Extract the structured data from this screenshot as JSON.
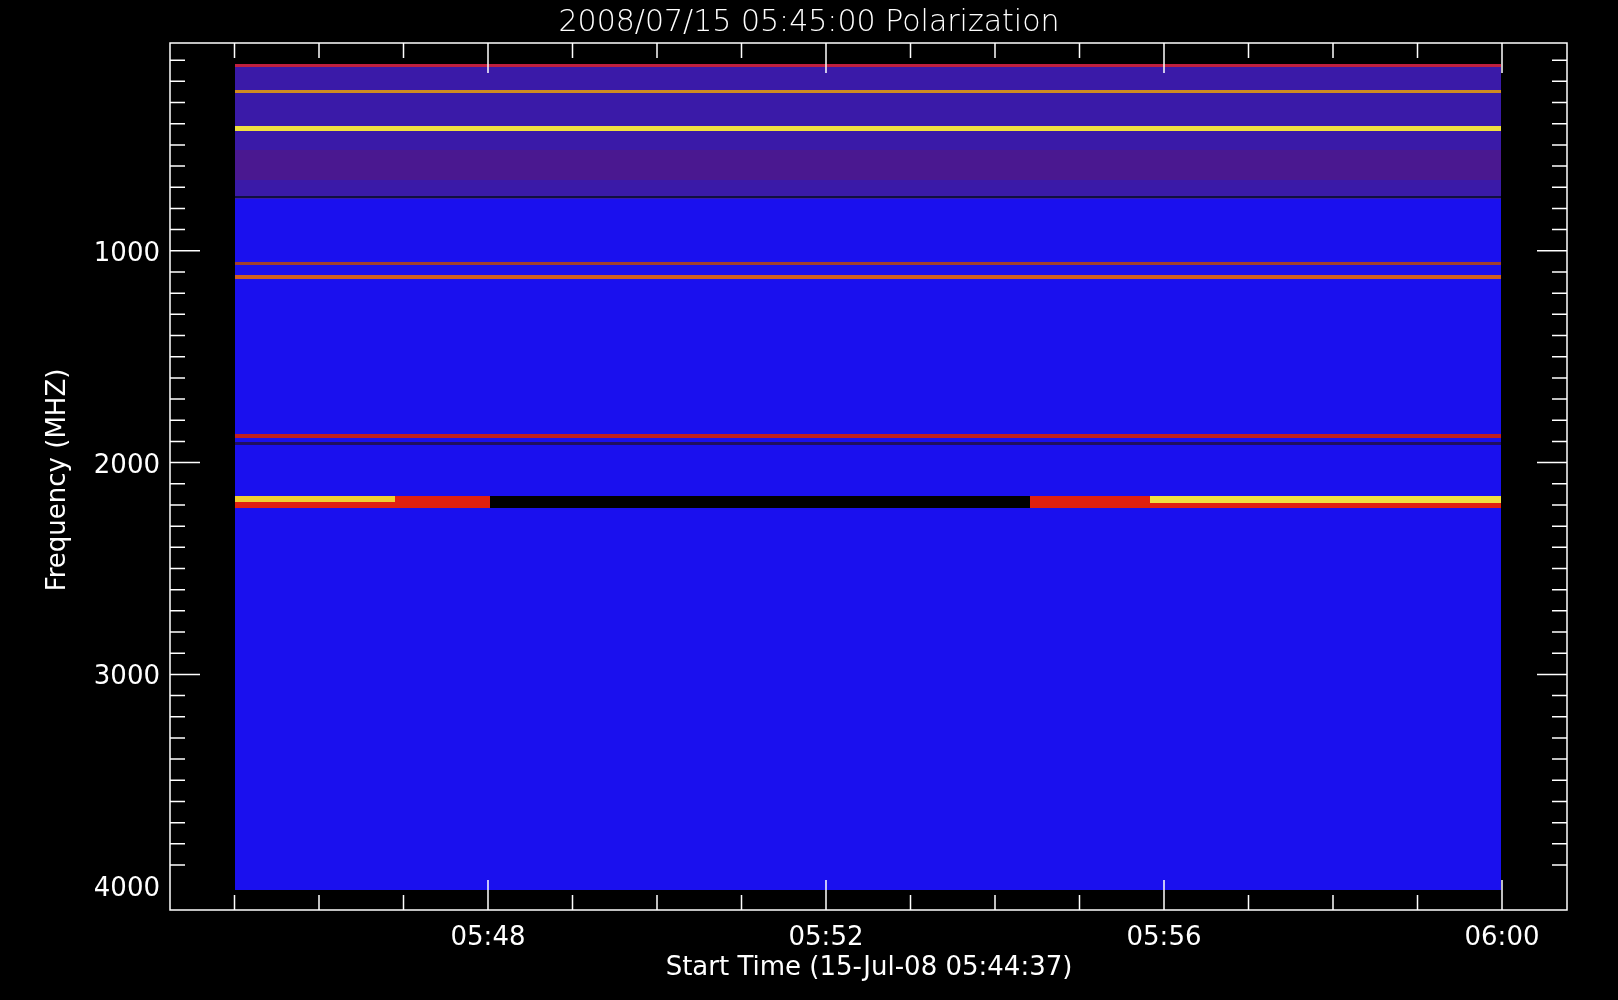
{
  "title": "2008/07/15 05:45:00 Polarization",
  "y_axis": {
    "label": "Frequency (MHZ)",
    "ticks": [
      "1000",
      "2000",
      "3000",
      "4000"
    ]
  },
  "x_axis": {
    "label": "Start Time (15-Jul-08 05:44:37)",
    "ticks": [
      "05:48",
      "05:52",
      "05:56",
      "06:00"
    ]
  }
}
